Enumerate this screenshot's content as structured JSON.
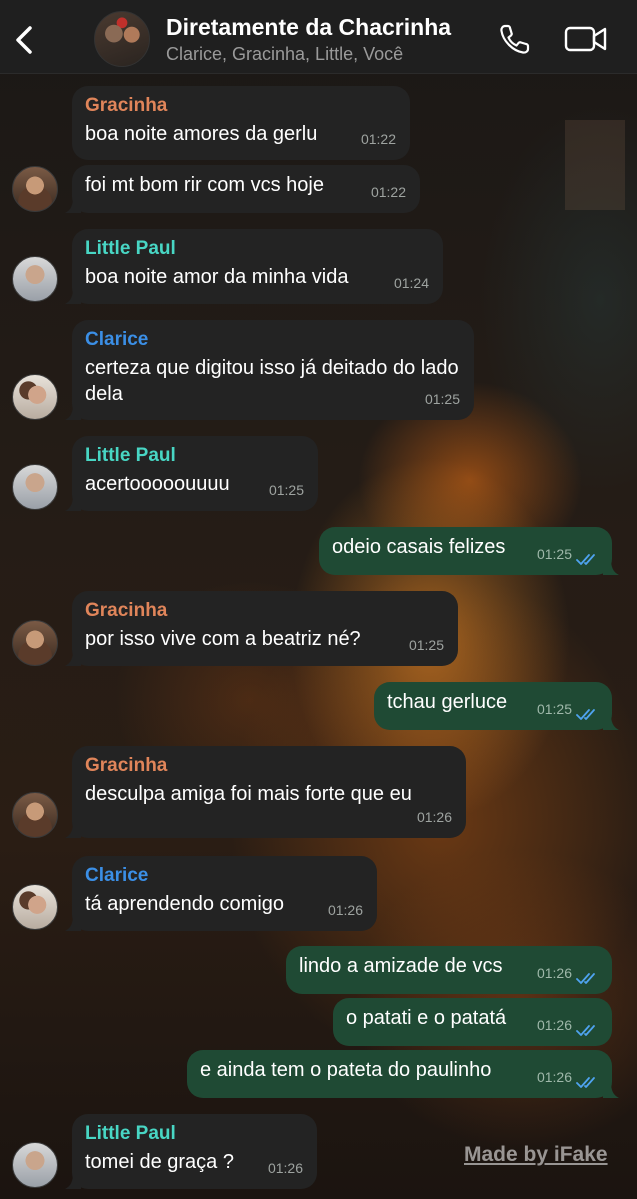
{
  "header": {
    "title": "Diretamente da Chacrinha",
    "subtitle": "Clarice, Gracinha, Little, Você",
    "back_icon": "chevron-left-icon",
    "call_icon": "phone-icon",
    "video_icon": "video-camera-icon"
  },
  "messages": [
    {
      "sender": "Gracinha",
      "text": "boa noite amores da gerlu",
      "time": "01:22"
    },
    {
      "sender": "",
      "text": "foi mt bom rir com vcs hoje",
      "time": "01:22"
    },
    {
      "sender": "Little Paul",
      "text": "boa noite amor da minha vida",
      "time": "01:24"
    },
    {
      "sender": "Clarice",
      "text": "certeza que digitou isso já deitado do lado dela",
      "time": "01:25"
    },
    {
      "sender": "Little Paul",
      "text": "acertooooouuuu",
      "time": "01:25"
    },
    {
      "sender": "",
      "text": "odeio casais felizes",
      "time": "01:25"
    },
    {
      "sender": "Gracinha",
      "text": "por isso vive com a beatriz né?",
      "time": "01:25"
    },
    {
      "sender": "",
      "text": "tchau gerluce",
      "time": "01:25"
    },
    {
      "sender": "Gracinha",
      "text": "desculpa amiga foi mais forte que eu",
      "time": "01:26"
    },
    {
      "sender": "Clarice",
      "text": "tá aprendendo comigo",
      "time": "01:26"
    },
    {
      "sender": "",
      "text": "lindo a amizade de vcs",
      "time": "01:26"
    },
    {
      "sender": "",
      "text": "o patati e o patatá",
      "time": "01:26"
    },
    {
      "sender": "",
      "text": "e ainda tem o pateta do paulinho",
      "time": "01:26"
    },
    {
      "sender": "Little Paul",
      "text": "tomei de graça ?",
      "time": "01:26"
    }
  ],
  "watermark": "Made by iFake",
  "colors": {
    "outgoing_bubble": "#1f4a34",
    "incoming_bubble": "#232323",
    "gracinha": "#e0855a",
    "little_paul": "#48d6c4",
    "clarice": "#3b8fe6",
    "read_ticks": "#4fa3f0"
  }
}
